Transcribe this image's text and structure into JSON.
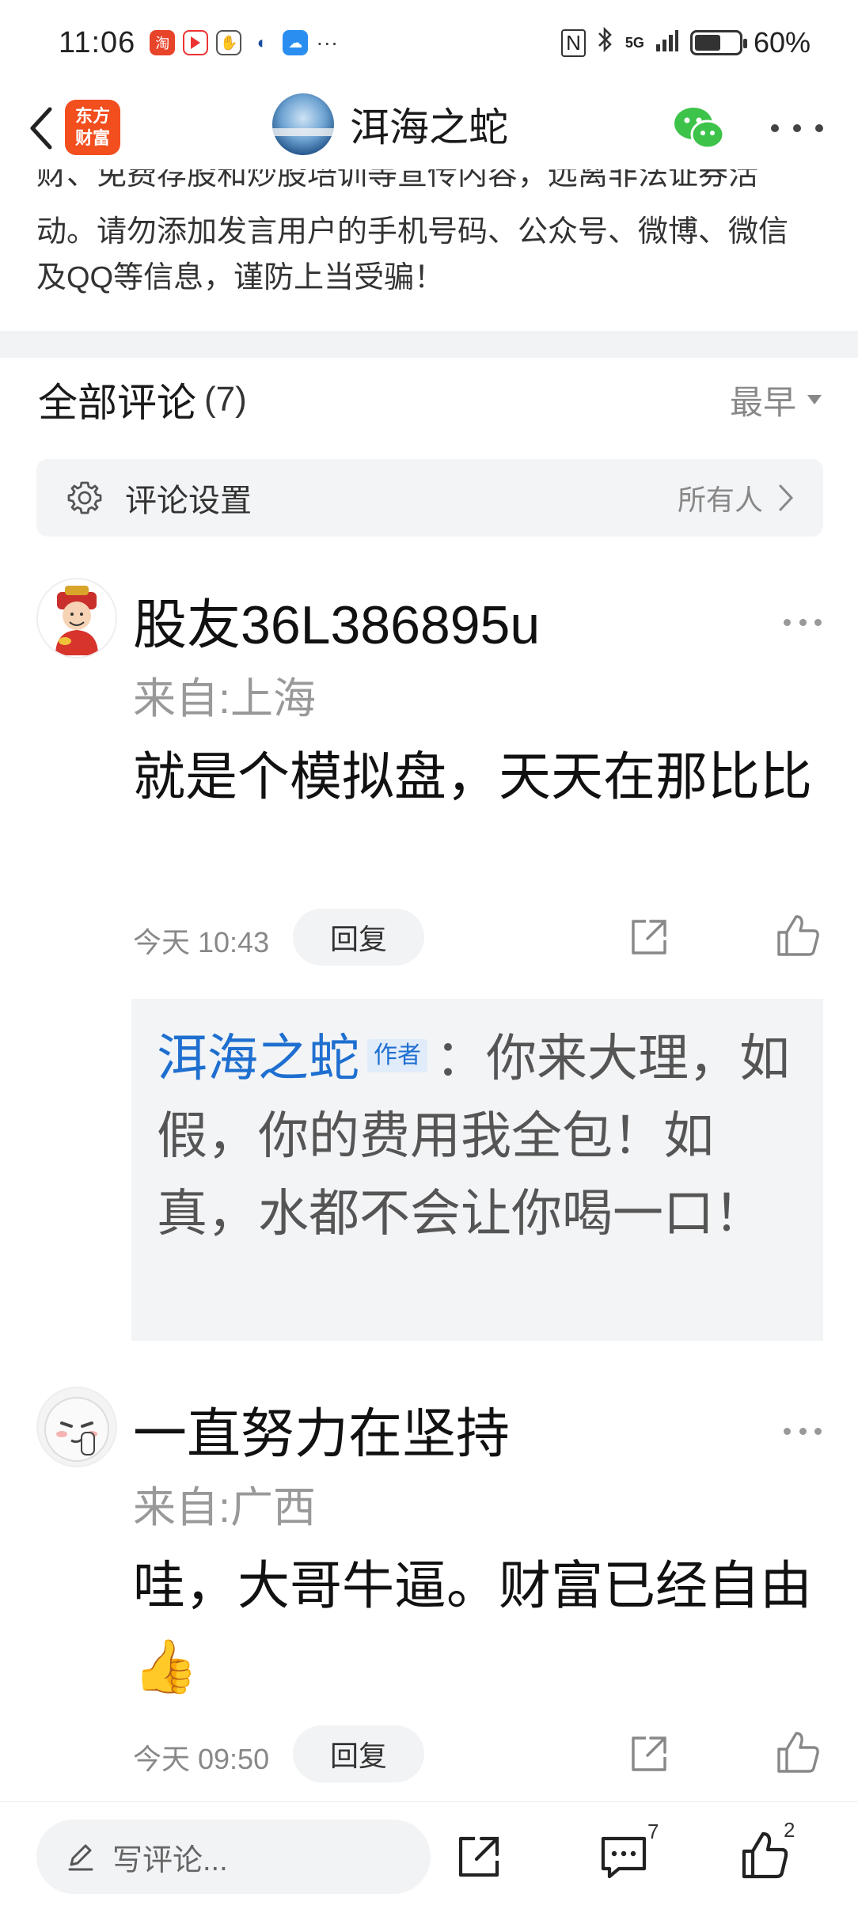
{
  "status_bar": {
    "time": "11:06",
    "overflow": "···",
    "network": "5G",
    "battery_percent_label": "60%",
    "battery_level": 0.6
  },
  "header": {
    "logo_text": "东方\n财富",
    "title": "洱海之蛇"
  },
  "notice": {
    "lines": [
      "财、免费荐股和炒股培训等宣传内容，远离非法证券活",
      "动。请勿添加发言用户的手机号码、公众号、微博、微信",
      "及QQ等信息，谨防上当受骗！"
    ]
  },
  "comments_section": {
    "title": "全部评论",
    "count": "(7)",
    "sort_label": "最早",
    "settings": {
      "label": "评论设置",
      "value": "所有人"
    }
  },
  "comments": [
    {
      "name": "股友36L386895u",
      "location": "来自:上海",
      "text": "就是个模拟盘，天天在那比比",
      "time": "今天 10:43",
      "reply_label": "回复",
      "reply": {
        "author": "洱海之蛇",
        "tag": "作者",
        "text": "：你来大理，如假，你的费用我全包！如真，水都不会让你喝一口！"
      }
    },
    {
      "name": "一直努力在坚持",
      "location": "来自:广西",
      "text": "哇，大哥牛逼。财富已经自由👍",
      "time": "今天 09:50",
      "reply_label": "回复"
    }
  ],
  "bottom_bar": {
    "write_placeholder": "写评论...",
    "comment_count": "7",
    "like_count": "2"
  },
  "colors": {
    "accent_blue": "#1e6fd0",
    "brand_orange": "#f24e1e",
    "wechat_green": "#3dc34a"
  }
}
